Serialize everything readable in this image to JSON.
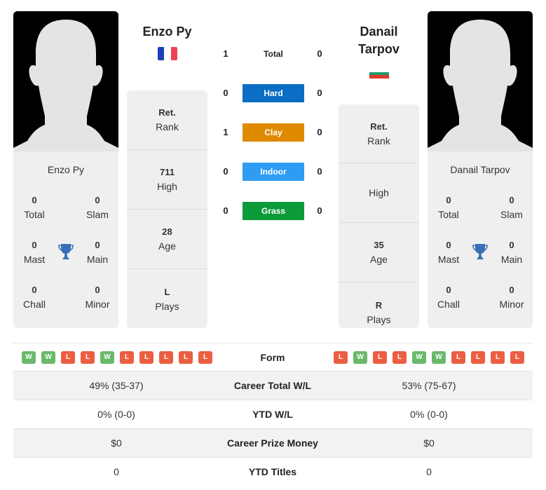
{
  "player1": {
    "name": "Enzo Py",
    "header_name": "Enzo Py",
    "country_flag": "france",
    "flag_colors": [
      "#1f3fb8",
      "#ffffff",
      "#ee4455"
    ],
    "titles": {
      "total": {
        "value": "0",
        "label": "Total"
      },
      "slam": {
        "value": "0",
        "label": "Slam"
      },
      "mast": {
        "value": "0",
        "label": "Mast"
      },
      "main": {
        "value": "0",
        "label": "Main"
      },
      "chall": {
        "value": "0",
        "label": "Chall"
      },
      "minor": {
        "value": "0",
        "label": "Minor"
      }
    },
    "info": [
      {
        "value": "Ret.",
        "label": "Rank"
      },
      {
        "value": "711",
        "label": "High"
      },
      {
        "value": "28",
        "label": "Age"
      },
      {
        "value": "L",
        "label": "Plays"
      }
    ],
    "form": [
      "W",
      "W",
      "L",
      "L",
      "W",
      "L",
      "L",
      "L",
      "L",
      "L"
    ]
  },
  "player2": {
    "name": "Danail Tarpov",
    "header_name_line1": "Danail",
    "header_name_line2": "Tarpov",
    "country_flag": "bulgaria",
    "flag_colors": [
      "#ffffff",
      "#1e9b6a",
      "#e23a2a"
    ],
    "titles": {
      "total": {
        "value": "0",
        "label": "Total"
      },
      "slam": {
        "value": "0",
        "label": "Slam"
      },
      "mast": {
        "value": "0",
        "label": "Mast"
      },
      "main": {
        "value": "0",
        "label": "Main"
      },
      "chall": {
        "value": "0",
        "label": "Chall"
      },
      "minor": {
        "value": "0",
        "label": "Minor"
      }
    },
    "info": [
      {
        "value": "Ret.",
        "label": "Rank"
      },
      {
        "value": "",
        "label": "High"
      },
      {
        "value": "35",
        "label": "Age"
      },
      {
        "value": "R",
        "label": "Plays"
      }
    ],
    "form": [
      "L",
      "W",
      "L",
      "L",
      "W",
      "W",
      "L",
      "L",
      "L",
      "L"
    ]
  },
  "h2h": [
    {
      "label": "Total",
      "p1": "1",
      "p2": "0",
      "color": ""
    },
    {
      "label": "Hard",
      "p1": "0",
      "p2": "0",
      "color": "#0a6ec4"
    },
    {
      "label": "Clay",
      "p1": "1",
      "p2": "0",
      "color": "#e08a00"
    },
    {
      "label": "Indoor",
      "p1": "0",
      "p2": "0",
      "color": "#2e9cf3"
    },
    {
      "label": "Grass",
      "p1": "0",
      "p2": "0",
      "color": "#0d9a3a"
    }
  ],
  "form_label": "Form",
  "stats": [
    {
      "label": "Career Total W/L",
      "p1": "49% (35-37)",
      "p2": "53% (75-67)"
    },
    {
      "label": "YTD W/L",
      "p1": "0% (0-0)",
      "p2": "0% (0-0)"
    },
    {
      "label": "Career Prize Money",
      "p1": "$0",
      "p2": "$0"
    },
    {
      "label": "YTD Titles",
      "p1": "0",
      "p2": "0"
    }
  ],
  "colors": {
    "win": "#6ab96b",
    "loss": "#ec5e42",
    "trophy": "#3a6fb8"
  }
}
